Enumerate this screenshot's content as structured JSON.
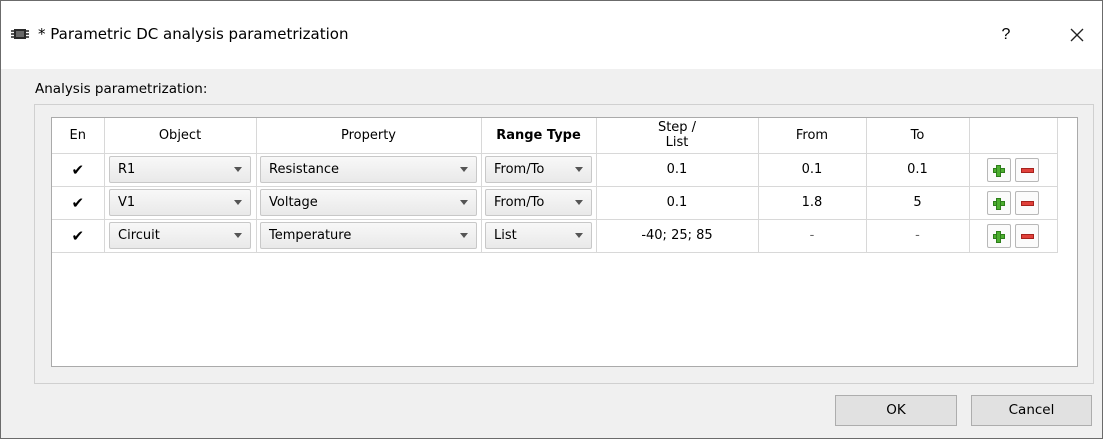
{
  "window": {
    "title": "* Parametric DC analysis parametrization",
    "help_label": "?"
  },
  "section_label": "Analysis parametrization:",
  "table": {
    "headers": {
      "en": "En",
      "object": "Object",
      "property": "Property",
      "range_type": "Range Type",
      "step_line1": "Step /",
      "step_line2": "List",
      "from": "From",
      "to": "To"
    },
    "rows": [
      {
        "enabled_mark": "✔",
        "object": "R1",
        "property": "Resistance",
        "range_type": "From/To",
        "step": "0.1",
        "from": "0.1",
        "to": "0.1"
      },
      {
        "enabled_mark": "✔",
        "object": "V1",
        "property": "Voltage",
        "range_type": "From/To",
        "step": "0.1",
        "from": "1.8",
        "to": "5"
      },
      {
        "enabled_mark": "✔",
        "object": "Circuit",
        "property": "Temperature",
        "range_type": "List",
        "step": "-40; 25; 85",
        "from": "-",
        "to": "-"
      }
    ]
  },
  "buttons": {
    "ok": "OK",
    "cancel": "Cancel"
  },
  "icons": {
    "app": "schematic-chip-icon",
    "close": "close-icon",
    "add_row": "plus-icon",
    "remove_row": "minus-icon",
    "dropdown": "chevron-down-icon"
  },
  "colors": {
    "plus": "#4cae2f",
    "minus": "#e0403a"
  }
}
